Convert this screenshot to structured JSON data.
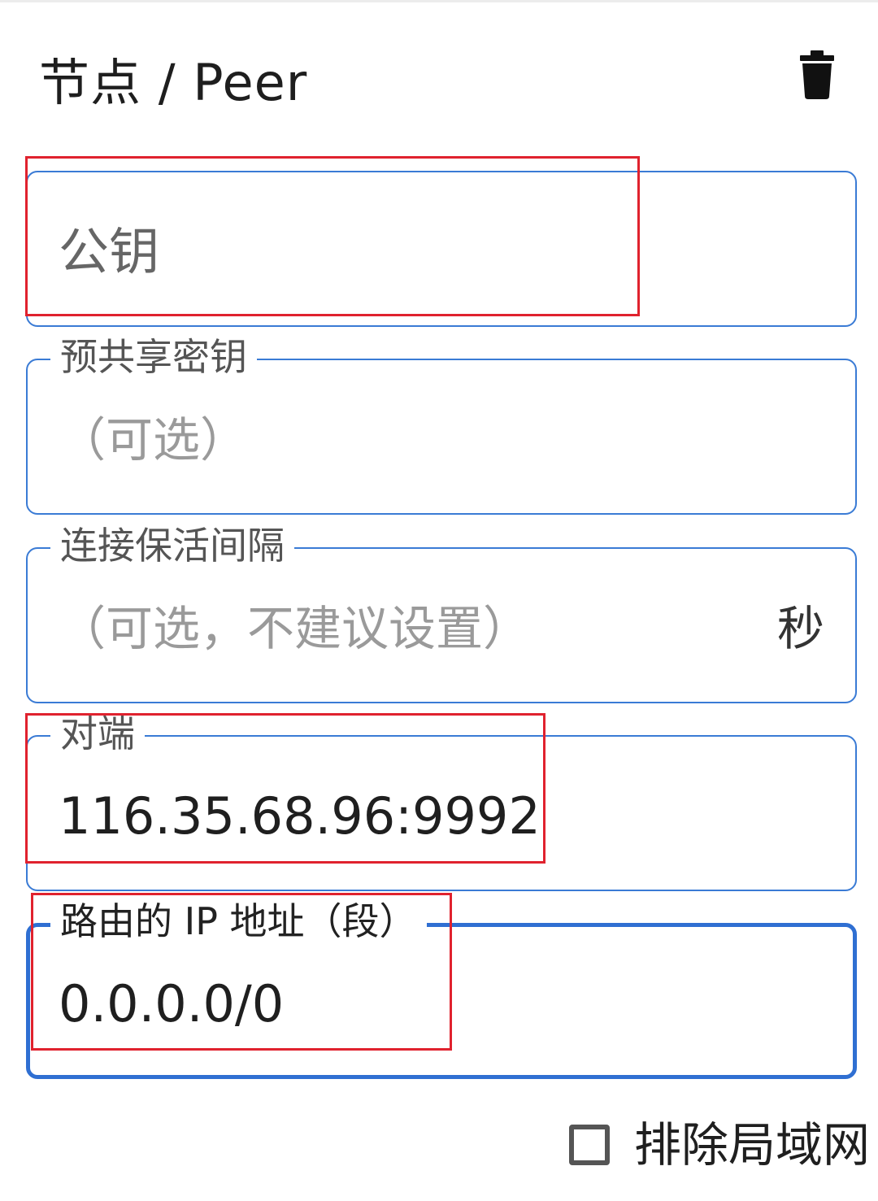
{
  "header": {
    "title": "节点 / Peer",
    "delete_icon": "trash-icon"
  },
  "fields": {
    "public_key": {
      "label": "公钥",
      "value": ""
    },
    "preshared_key": {
      "label": "预共享密钥",
      "placeholder": "（可选）"
    },
    "persistent_keepalive": {
      "label": "连接保活间隔",
      "placeholder": "（可选，不建议设置）",
      "suffix": "秒"
    },
    "endpoint": {
      "label": "对端",
      "value": "116.35.68.96:9992"
    },
    "allowed_ips": {
      "label": "路由的 IP 地址（段）",
      "value": "0.0.0.0/0"
    }
  },
  "exclude_lan": {
    "label": "排除局域网",
    "checked": false
  },
  "colors": {
    "field_border": "#3a7bd5",
    "focused_border": "#2f6fd2",
    "annotation_red": "#e0222e"
  }
}
